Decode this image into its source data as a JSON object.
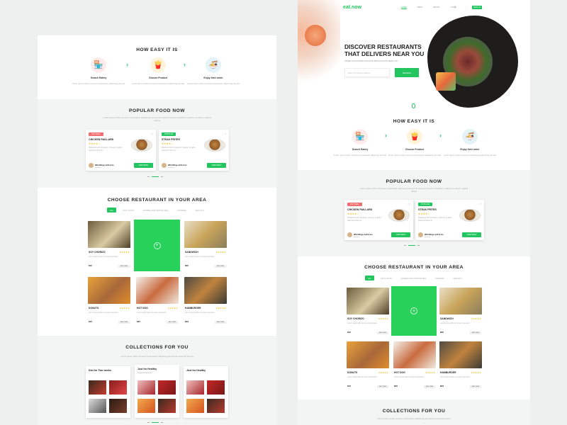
{
  "brand": {
    "logo": "eat.now",
    "accent": "#22c55e"
  },
  "nav": {
    "links": [
      "HOME",
      "MENU",
      "BRAND",
      "LOGIN"
    ],
    "cta": "SIGN UP"
  },
  "hero": {
    "title_line1": "DISCOVER RESTAURANTS",
    "title_line2": "THAT DELIVERS NEAR YOU",
    "subtitle": "ORDER FOOD FROM FAVOURITE RESTAURANTS NEAR YOU",
    "search_placeholder": "Enter The Delivery Address",
    "search_button": "SEARCH"
  },
  "how": {
    "title": "HOW EASY IT IS",
    "steps": [
      {
        "icon": "store-icon",
        "title": "Search Eatery",
        "desc": "Lorem ipsum dolor sit amet consectetur adipiscing elit sed"
      },
      {
        "icon": "fries-icon",
        "title": "Choose Product",
        "desc": "Lorem ipsum dolor sit amet consectetur adipiscing elit sed"
      },
      {
        "icon": "bowl-icon",
        "title": "Enjoy their order",
        "desc": "Lorem ipsum dolor sit amet consectetur adipiscing elit sed"
      }
    ]
  },
  "popular": {
    "title": "POPULAR FOOD NOW",
    "subtitle": "Lorem ipsum dolor sit amet consectetur adipiscing elit sed do eiusmod tempor incididunt ut labore et dolore magna aliqua",
    "cards": [
      {
        "badge": "HOT DEAL",
        "badge_color": "#f26d6d",
        "name": "CHICKEN PAILLARD",
        "stars": "★★★★☆",
        "desc": "Flattened with tomatoes, cheese, & garlic, basil and olive oil",
        "restaurant": "Wild Wings Grill & Go",
        "location": "Brooklyn",
        "button": "VIEW MENU"
      },
      {
        "badge": "POPULAR",
        "badge_color": "#22c55e",
        "name": "STEAK FRITES",
        "stars": "★★★★☆",
        "desc": "Flattened with tomatoes, cheese, & garlic, basil and olive oil",
        "restaurant": "Wild Wings Grill & Go",
        "location": "Brooklyn",
        "button": "VIEW MENU"
      }
    ]
  },
  "restaurants": {
    "title": "CHOOSE RESTAURANT IN YOUR AREA",
    "tabs": [
      "ALL",
      "FAST FOOD",
      "DAIRIES AND SMOOTHIES",
      "CHINESE",
      "HEALTHY"
    ],
    "items": [
      {
        "name": "SOY CHORIZO",
        "stars": "★★★★★",
        "desc": "Lorem ipsum dolor sit amet consectetur",
        "price": "$10",
        "button": "ADD ITEM",
        "color": "#b49a6e"
      },
      {
        "name": "SANDWICH",
        "stars": "★★★★★",
        "desc": "Lorem ipsum dolor sit amet consectetur",
        "price": "$20",
        "button": "ADD ITEM",
        "color": "#c9a45a"
      },
      {
        "name": "DONUTS",
        "stars": "★★★★★",
        "desc": "Lorem ipsum dolor sit amet consectetur",
        "price": "$15",
        "button": "ADD ITEM",
        "color": "#b87a4f"
      },
      {
        "name": "HOT DOG",
        "stars": "★★★★★",
        "desc": "Lorem ipsum dolor sit amet consectetur",
        "price": "$25",
        "button": "ADD ITEM",
        "color": "#c96b3f"
      },
      {
        "name": "HAMBURGER",
        "stars": "★★★★★",
        "desc": "Lorem ipsum dolor sit amet consectetur",
        "price": "$22",
        "button": "ADD ITEM",
        "color": "#8a6a4a"
      }
    ]
  },
  "collections": {
    "title": "COLLECTIONS FOR YOU",
    "subtitle": "Lorem ipsum dolor sit amet consectetur adipiscing elit sed do eiusmod tempor",
    "cards": [
      {
        "title": "Diet for Two weeks",
        "sub": "Featured Recipes"
      },
      {
        "title": "Just for Healthy",
        "sub": "Featured Recipes"
      },
      {
        "title": "Just for Healthy",
        "sub": "Featured Recipes"
      }
    ]
  }
}
